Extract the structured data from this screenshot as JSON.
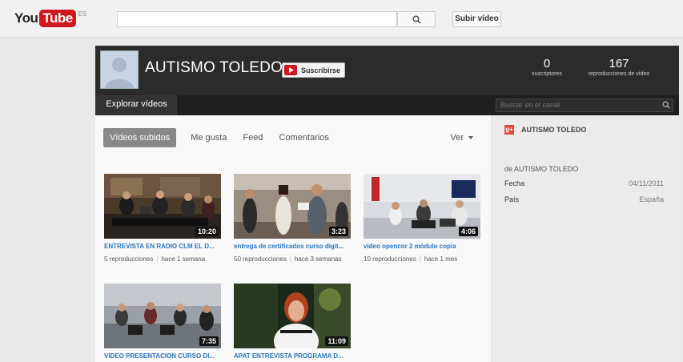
{
  "masthead": {
    "logo_you": "You",
    "logo_tube": "Tube",
    "logo_region": "ES",
    "search_value": "",
    "search_placeholder": "",
    "upload_label": "Subir vídeo"
  },
  "channel": {
    "name": "AUTISMO TOLEDO",
    "subscribe_label": "Suscribirse",
    "stats": [
      {
        "value": "0",
        "label": "suscriptores"
      },
      {
        "value": "167",
        "label": "reproducciones de vídeo"
      }
    ]
  },
  "nav": {
    "explore_label": "Explorar vídeos",
    "search_placeholder": "Buscar en el canal"
  },
  "tabs": [
    "Vídeos subidos",
    "Me gusta",
    "Feed",
    "Comentarios"
  ],
  "view_label": "Ver",
  "videos": [
    {
      "title": "ENTREVISTA EN RADIO CLM EL D...",
      "duration": "10:20",
      "views": "5 reproducciones",
      "age": "hace 1 semana"
    },
    {
      "title": "entrega de certificados curso digit...",
      "duration": "3:23",
      "views": "50 reproducciones",
      "age": "hace 3 semanas"
    },
    {
      "title": "video opencor 2 módulo copia",
      "duration": "4:06",
      "views": "10 reproducciones",
      "age": "hace 1 mes"
    },
    {
      "title": "VIDEO PRESENTACION CURSO DI...",
      "duration": "7:35",
      "views": "",
      "age": ""
    },
    {
      "title": "APAT ENTREVISTA PROGRAMA D...",
      "duration": "11:09",
      "views": "",
      "age": ""
    }
  ],
  "sidebar": {
    "gplus_label": "g+",
    "name": "AUTISMO TOLEDO",
    "from": "de AUTISMO TOLEDO",
    "rows": [
      {
        "label": "Fecha",
        "value": "04/11/2011"
      },
      {
        "label": "País",
        "value": "España"
      }
    ]
  },
  "colors": {
    "brand_red": "#cc181e",
    "header_dark": "#2b2b2b",
    "link_blue": "#2a76c6"
  }
}
